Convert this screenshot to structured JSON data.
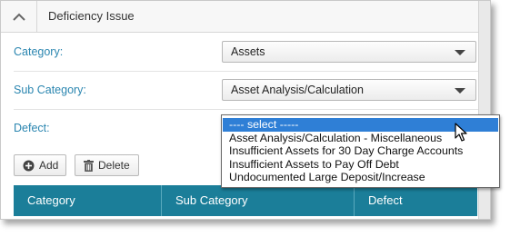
{
  "section": {
    "title": "Deficiency Issue"
  },
  "fields": {
    "category": {
      "label": "Category:",
      "value": "Assets"
    },
    "sub_category": {
      "label": "Sub Category:",
      "value": "Asset Analysis/Calculation"
    },
    "defect": {
      "label": "Defect:",
      "options": [
        "---- select -----",
        "Asset Analysis/Calculation - Miscellaneous",
        "Insufficient Assets for 30 Day Charge Accounts",
        "Insufficient Assets to Pay Off Debt",
        "Undocumented Large Deposit/Increase"
      ]
    }
  },
  "toolbar": {
    "add_label": "Add",
    "delete_label": "Delete"
  },
  "grid": {
    "columns": [
      "Category",
      "Sub Category",
      "Defect"
    ]
  },
  "colors": {
    "label": "#2b86b0",
    "grid_header": "#1b7e99",
    "selected_option": "#2f7fd6"
  },
  "icons": {
    "collapse": "chevron-up-icon",
    "add": "plus-circle-icon",
    "delete": "trash-icon",
    "cursor": "mouse-pointer-icon"
  }
}
